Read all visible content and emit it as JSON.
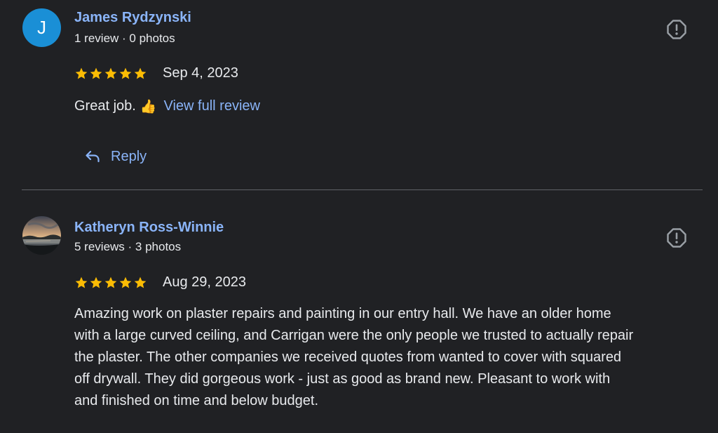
{
  "reviews": [
    {
      "avatar_letter": "J",
      "avatar_color": "#1a8fd6",
      "name": "James Rydzynski",
      "meta": "1 review · 0 photos",
      "rating": 5,
      "date": "Sep 4, 2023",
      "text": "Great job.",
      "emoji": "👍",
      "link_label": "View full review",
      "reply_label": "Reply"
    },
    {
      "avatar_image": "photo",
      "name": "Katheryn Ross-Winnie",
      "meta": "5 reviews · 3 photos",
      "rating": 5,
      "date": "Aug 29, 2023",
      "text_lines": [
        "Amazing work on plaster repairs and painting in our entry hall. We have an older home",
        "with a large curved ceiling, and Carrigan were the only people we trusted to actually repair",
        "the plaster. The other companies we received quotes from wanted to cover with squared",
        "off drywall. They did gorgeous work - just as good as brand new. Pleasant to work with",
        "and finished on time and below budget."
      ]
    }
  ],
  "colors": {
    "background": "#202124",
    "link": "#8ab4f8",
    "text": "#e8eaed",
    "star": "#fbbc04",
    "divider": "#5f6368"
  },
  "icons": {
    "flag": "flag-review-icon",
    "star": "star-icon",
    "reply": "reply-arrow-icon"
  }
}
